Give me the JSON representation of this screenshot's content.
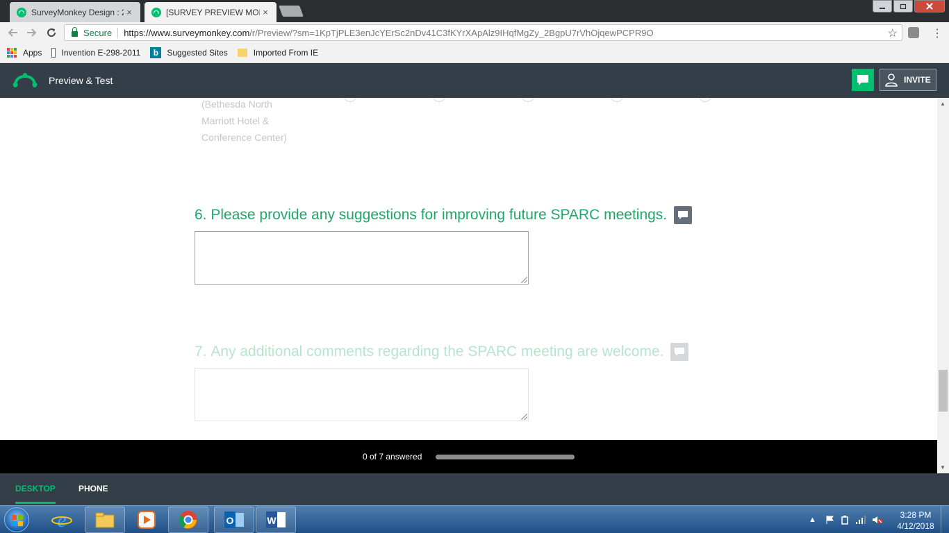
{
  "browser": {
    "tabs": [
      {
        "title": "SurveyMonkey Design : 2",
        "active": false
      },
      {
        "title": "[SURVEY PREVIEW MODE",
        "active": true
      }
    ],
    "close_glyph": "×",
    "address": {
      "secure_label": "Secure",
      "url_host": "https://www.surveymonkey.com",
      "url_path": "/r/Preview/?sm=1KpTjPLE3enJcYErSc2nDv41C3fKYrXApAlz9IHqfMgZy_2BgpU7rVhOjqewPCPR9O"
    },
    "bookmarks": [
      {
        "label": "Apps",
        "icon": "apps-grid-icon"
      },
      {
        "label": "Invention E-298-2011",
        "icon": "page-icon"
      },
      {
        "label": "Suggested Sites",
        "icon": "bing-icon"
      },
      {
        "label": "Imported From IE",
        "icon": "folder-icon"
      }
    ]
  },
  "app": {
    "title": "Preview & Test",
    "invite_label": "INVITE",
    "brand_color": "#00bf6f",
    "header_color": "#333e48"
  },
  "survey": {
    "previous_answer_lines": [
      "(Bethesda North",
      "Marriott Hotel &",
      "Conference Center)"
    ],
    "questions": [
      {
        "number": "6.",
        "text": "Please provide any suggestions for improving future SPARC meetings.",
        "answer": ""
      },
      {
        "number": "7.",
        "text": "Any additional comments regarding the SPARC meeting are welcome.",
        "answer": ""
      }
    ]
  },
  "progress": {
    "label": "0 of 7 answered",
    "answered": 0,
    "total": 7
  },
  "device_toggle": {
    "desktop_label": "DESKTOP",
    "phone_label": "PHONE",
    "selected": "desktop"
  },
  "taskbar": {
    "time": "3:28 PM",
    "date": "4/12/2018",
    "apps": [
      "internet-explorer-icon",
      "file-explorer-icon",
      "media-player-icon",
      "chrome-icon",
      "outlook-icon",
      "word-icon"
    ]
  }
}
